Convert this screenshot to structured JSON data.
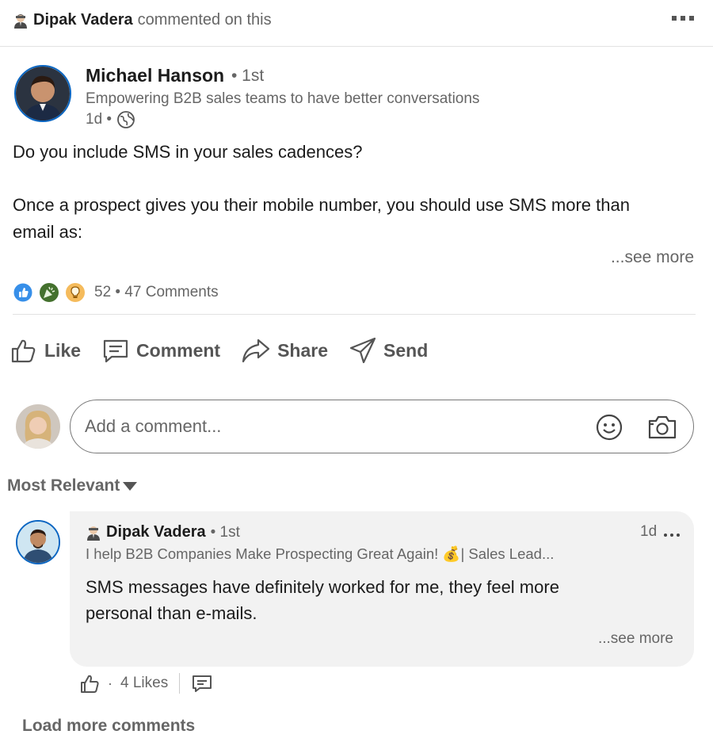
{
  "notification": {
    "commenter": "Dipak Vadera",
    "action_text": "commented on this"
  },
  "post": {
    "author_name": "Michael Hanson",
    "author_degree": "• 1st",
    "author_headline": "Empowering B2B sales teams to have better conversations",
    "time": "1d •",
    "text_line1": "Do you include SMS in your sales cadences?",
    "text_line2": "Once a prospect gives you their mobile number, you should use SMS more than",
    "text_line3": "email as:",
    "see_more": "...see more",
    "reaction_summary": "52 • 47 Comments"
  },
  "actions": {
    "like": "Like",
    "comment": "Comment",
    "share": "Share",
    "send": "Send"
  },
  "comment_input": {
    "placeholder": "Add a comment..."
  },
  "sort": {
    "label": "Most Relevant"
  },
  "comment": {
    "author_name": "Dipak Vadera",
    "author_degree": "• 1st",
    "time": "1d",
    "headline": "I help B2B Companies Make Prospecting Great Again! 💰| Sales Lead...",
    "text_line1": "SMS messages have definitely worked for me, they feel more",
    "text_line2": "personal than e-mails.",
    "see_more": "...see more",
    "dot": "·",
    "likes": "4 Likes"
  },
  "load_more": "Load more comments",
  "colors": {
    "brand_blue": "#0a66c2",
    "secondary_text": "#666666",
    "bubble_bg": "#f2f2f2"
  }
}
